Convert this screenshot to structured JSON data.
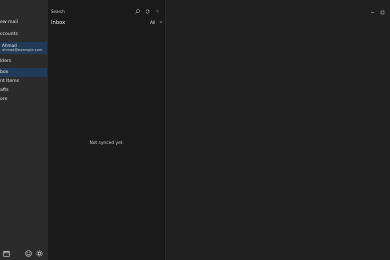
{
  "sidebar": {
    "new_mail_label": "ew mail",
    "accounts_header": "ccounts",
    "account_name": "Ahmad",
    "account_email": "ahmad@example.com",
    "folders_header": "lders",
    "folders": [
      {
        "label": "box",
        "selected": true
      },
      {
        "label": "nt Items",
        "selected": false
      },
      {
        "label": "afts",
        "selected": false
      },
      {
        "label": "ore",
        "selected": false
      }
    ],
    "bottom_icons": [
      "calendar-icon",
      "smiley-icon",
      "gear-icon"
    ]
  },
  "list": {
    "search_placeholder": "Search",
    "title": "Inbox",
    "filter_label": "All",
    "empty_message": "Not synced yet"
  },
  "colors": {
    "sidebar_bg": "#2b2b2b",
    "list_bg": "#1a1a1a",
    "reading_bg": "#202020",
    "selected_bg": "#213a57"
  }
}
